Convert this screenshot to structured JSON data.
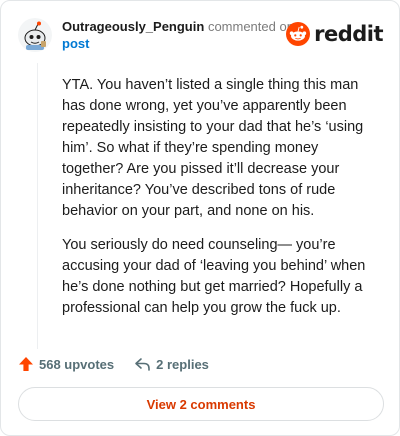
{
  "header": {
    "username": "Outrageously_Penguin",
    "commented_text": "commented on",
    "post_link": "post",
    "brand": "reddit",
    "avatar_icon": "snoo-avatar-icon",
    "logo_icon": "reddit-logo-icon"
  },
  "comment": {
    "paragraphs": [
      "YTA. You haven’t listed a single thing this man has done wrong, yet you’ve apparently been repeatedly insisting to your dad that he’s ‘using him’. So what if they’re spending money together? Are you pissed it’ll decrease your inheritance? You’ve described tons of rude behavior on your part, and none on his.",
      "You seriously do need counseling— you’re accusing your dad of ‘leaving you behind’ when he’s done nothing but get married? Hopefully a professional can help you grow the fuck up."
    ]
  },
  "actions": {
    "upvotes": "568 upvotes",
    "replies": "2 replies",
    "view_comments": "View 2 comments"
  },
  "colors": {
    "brand_orange": "#ff4500",
    "link_blue": "#0079d3",
    "button_text": "#d93900"
  }
}
